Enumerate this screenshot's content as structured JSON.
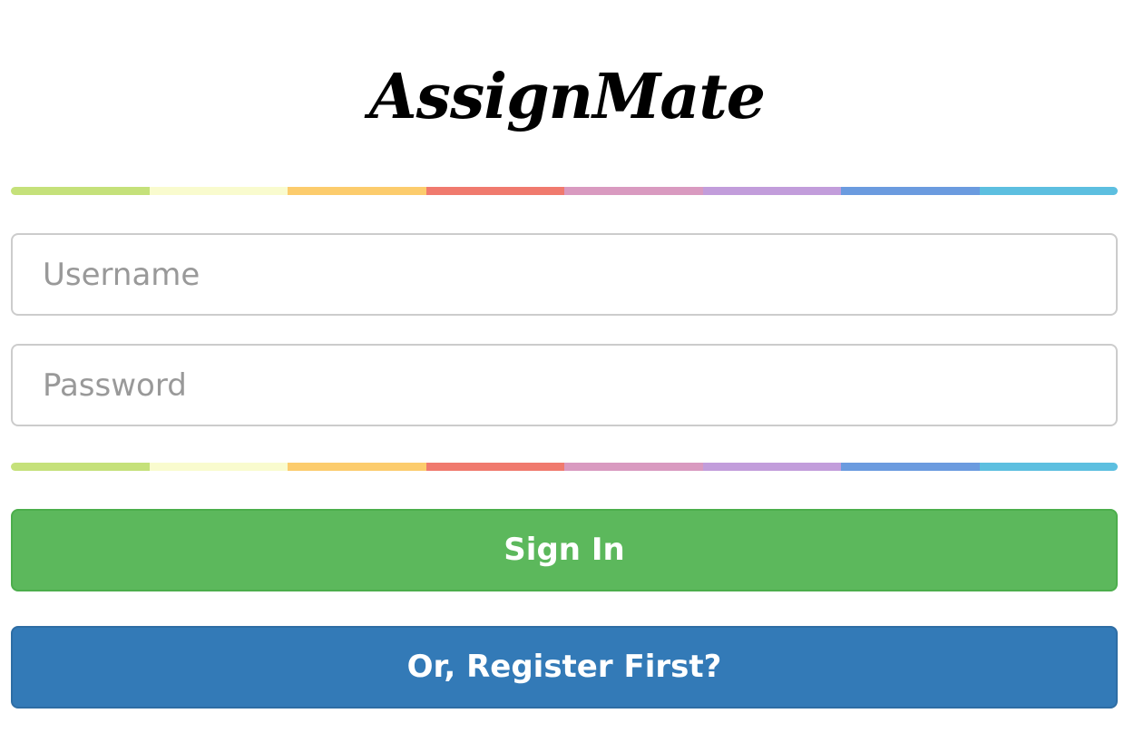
{
  "brand": {
    "title": "AssignMate"
  },
  "login_form": {
    "username_placeholder": "Username",
    "password_placeholder": "Password",
    "signin_label": "Sign In",
    "register_label": "Or, Register First?"
  },
  "colors": {
    "signin_bg": "#5cb85c",
    "register_bg": "#337ab7",
    "stripe": [
      "#c5e17a",
      "#f9fbce",
      "#fccc6d",
      "#f07a6e",
      "#d99ac0",
      "#c29ddb",
      "#6b9bdf",
      "#5dbfe0"
    ]
  }
}
